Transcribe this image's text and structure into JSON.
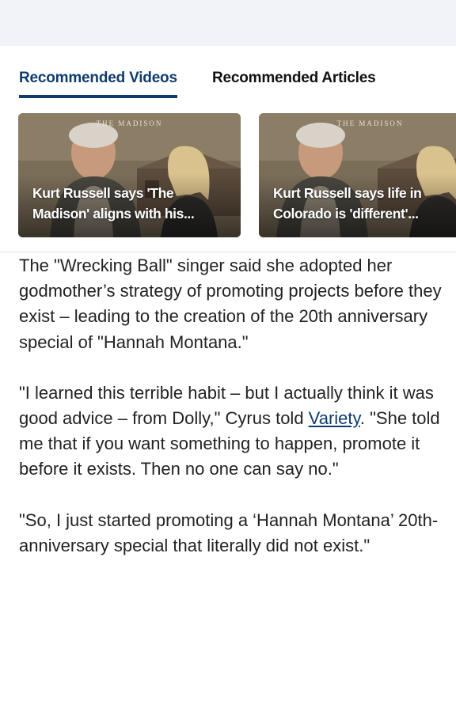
{
  "tabs": {
    "videos_label": "Recommended Videos",
    "articles_label": "Recommended Articles"
  },
  "cards": [
    {
      "logo": "THE MADISON",
      "title": "Kurt Russell says 'The Madison' aligns with his..."
    },
    {
      "logo": "THE MADISON",
      "title": "Kurt Russell says life in Colorado is 'different'..."
    }
  ],
  "article": {
    "p1": "The \"Wrecking Ball\" singer said she adopted her godmother’s strategy of promoting projects before they exist – leading to the creation of the 20th anniversary special of \"Hannah Montana.\"",
    "p2_before": "\"I learned this terrible habit – but I actually think it was good advice – from Dolly,\" Cyrus told ",
    "p2_link": "Variety",
    "p2_after": ". \"She told me that if you want something to happen, promote it before it exists. Then no one can say no.\"",
    "p3": "\"So, I just started promoting a ‘Hannah Montana’ 20th-anniversary special that literally did not exist.\""
  },
  "colors": {
    "accent": "#0f3c6e",
    "top_band": "#f1f3f8",
    "body_text": "#222222"
  }
}
